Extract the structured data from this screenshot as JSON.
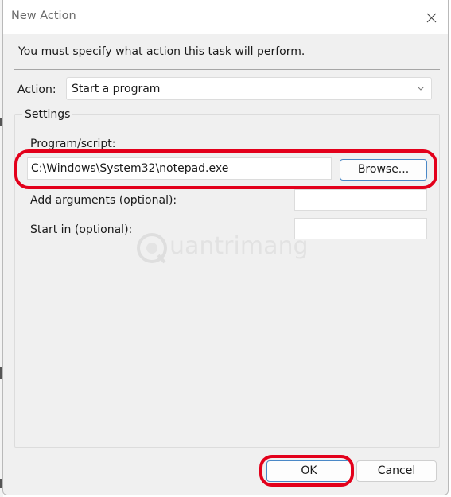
{
  "window": {
    "title": "New Action"
  },
  "instruction": "You must specify what action this task will perform.",
  "action": {
    "label": "Action:",
    "selected": "Start a program"
  },
  "settings": {
    "group_label": "Settings",
    "program_script": {
      "label": "Program/script:",
      "value": "C:\\Windows\\System32\\notepad.exe"
    },
    "browse_label": "Browse...",
    "arguments": {
      "label": "Add arguments (optional):",
      "value": ""
    },
    "start_in": {
      "label": "Start in (optional):",
      "value": ""
    }
  },
  "watermark": {
    "text": "uantrimang"
  },
  "buttons": {
    "ok_label": "OK",
    "cancel_label": "Cancel"
  },
  "colors": {
    "highlight": "#e3001b",
    "accent_border": "#4a88c7",
    "dialog_bg": "#f0f0f0"
  },
  "icons": {
    "close": "close-icon",
    "dropdown": "chevron-down-icon"
  }
}
